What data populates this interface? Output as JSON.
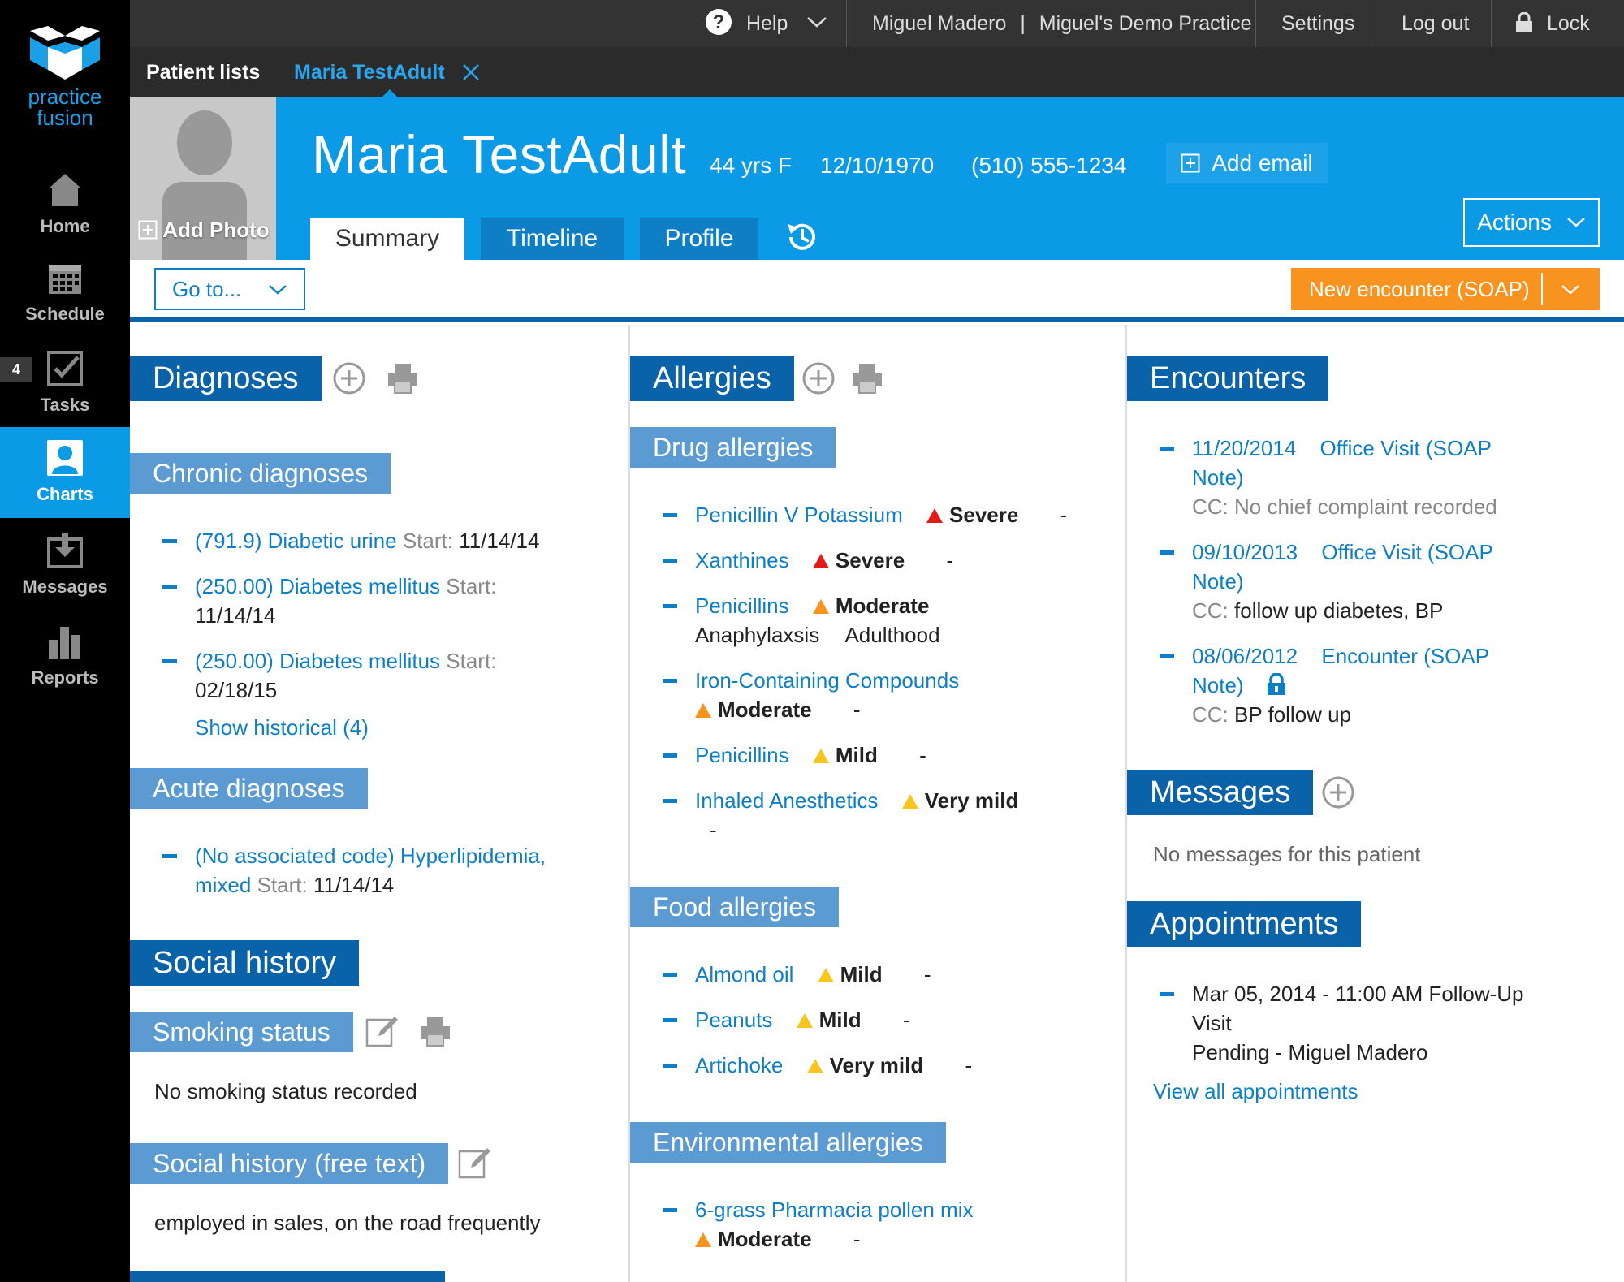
{
  "brand": {
    "line1": "practice",
    "line2": "fusion",
    "accent": "#0a9ae6"
  },
  "nav": [
    {
      "label": "Home",
      "icon": "home-icon"
    },
    {
      "label": "Schedule",
      "icon": "calendar-icon"
    },
    {
      "label": "Tasks",
      "icon": "checkbox-icon",
      "badge": "4"
    },
    {
      "label": "Charts",
      "icon": "person-icon",
      "active": true
    },
    {
      "label": "Messages",
      "icon": "inbox-icon"
    },
    {
      "label": "Reports",
      "icon": "bar-chart-icon"
    }
  ],
  "topbar": {
    "help": "Help",
    "user": "Miguel Madero",
    "separator": "|",
    "practice": "Miguel's Demo Practice",
    "settings": "Settings",
    "logout": "Log out",
    "lock": "Lock"
  },
  "subbar": {
    "patient_lists": "Patient lists",
    "open_tab": "Maria TestAdult"
  },
  "patient": {
    "name": "Maria TestAdult",
    "age_sex": "44 yrs F",
    "dob": "12/10/1970",
    "phone": "(510) 555-1234",
    "add_email": "Add email",
    "add_photo": "Add Photo"
  },
  "tabs": {
    "summary": "Summary",
    "timeline": "Timeline",
    "profile": "Profile"
  },
  "actions_label": "Actions",
  "goto_label": "Go to...",
  "new_encounter_label": "New encounter (SOAP)",
  "diagnoses": {
    "title": "Diagnoses",
    "chronic_title": "Chronic diagnoses",
    "chronic": [
      {
        "name": "(791.9) Diabetic urine",
        "start_label": "Start:",
        "start": "11/14/14"
      },
      {
        "name": "(250.00) Diabetes mellitus",
        "start_label": "Start:",
        "start": "11/14/14"
      },
      {
        "name": "(250.00) Diabetes mellitus",
        "start_label": "Start:",
        "start": "02/18/15"
      }
    ],
    "show_historical": "Show historical (4)",
    "acute_title": "Acute diagnoses",
    "acute": [
      {
        "name_line1": "(No associated code) Hyperlipidemia,",
        "name_line2": "mixed",
        "start_label": "Start:",
        "start": "11/14/14"
      }
    ]
  },
  "social": {
    "title": "Social history",
    "smoking_title": "Smoking status",
    "smoking_text": "No smoking status recorded",
    "free_title": "Social history (free text)",
    "free_text": "employed in sales, on the road frequently"
  },
  "allergies": {
    "title": "Allergies",
    "drug_title": "Drug allergies",
    "drug": [
      {
        "name": "Penicillin V Potassium",
        "severity": "Severe",
        "level": "severe",
        "extra": "-"
      },
      {
        "name": "Xanthines",
        "severity": "Severe",
        "level": "severe",
        "extra": "-"
      },
      {
        "name": "Penicillins",
        "severity": "Moderate",
        "level": "moderate",
        "reaction": "Anaphylaxsis",
        "onset": "Adulthood"
      },
      {
        "name": "Iron-Containing Compounds",
        "severity": "Moderate",
        "level": "moderate",
        "extra": "-"
      },
      {
        "name": "Penicillins",
        "severity": "Mild",
        "level": "mild",
        "extra": "-"
      },
      {
        "name": "Inhaled Anesthetics",
        "severity": "Very mild",
        "level": "mild",
        "extra": "-"
      }
    ],
    "food_title": "Food allergies",
    "food": [
      {
        "name": "Almond oil",
        "severity": "Mild",
        "extra": "-"
      },
      {
        "name": "Peanuts",
        "severity": "Mild",
        "extra": "-"
      },
      {
        "name": "Artichoke",
        "severity": "Very mild",
        "extra": "-"
      }
    ],
    "env_title": "Environmental allergies",
    "env": [
      {
        "name": "6-grass Pharmacia pollen mix",
        "severity": "Moderate",
        "extra": "-"
      }
    ]
  },
  "encounters": {
    "title": "Encounters",
    "items": [
      {
        "date": "11/20/2014",
        "type_line1": "Office Visit (SOAP",
        "type_line2": "Note)",
        "cc": "CC:",
        "cc_text": "No chief complaint recorded"
      },
      {
        "date": "09/10/2013",
        "type_line1": "Office Visit (SOAP",
        "type_line2": "Note)",
        "cc": "CC:",
        "cc_text": "follow up diabetes, BP"
      },
      {
        "date": "08/06/2012",
        "type_line1": "Encounter (SOAP",
        "type_line2": "Note)",
        "cc": "CC:",
        "cc_text": "BP follow up",
        "locked": true
      }
    ]
  },
  "messages": {
    "title": "Messages",
    "empty": "No messages for this patient"
  },
  "appointments": {
    "title": "Appointments",
    "items": [
      {
        "line1": "Mar 05, 2014 - 11:00 AM Follow-Up",
        "line2": "Visit",
        "line3": "Pending - Miguel Madero"
      }
    ],
    "view_all": "View all appointments"
  },
  "colors": {
    "header_blue": "#0a9ae6",
    "section_dark": "#0a62a8",
    "section_light": "#5b9bd1",
    "orange": "#f7931e",
    "link": "#0e7fc6",
    "severe": "#e31b1b",
    "moderate": "#f7931e",
    "mild": "#f7c51e"
  }
}
